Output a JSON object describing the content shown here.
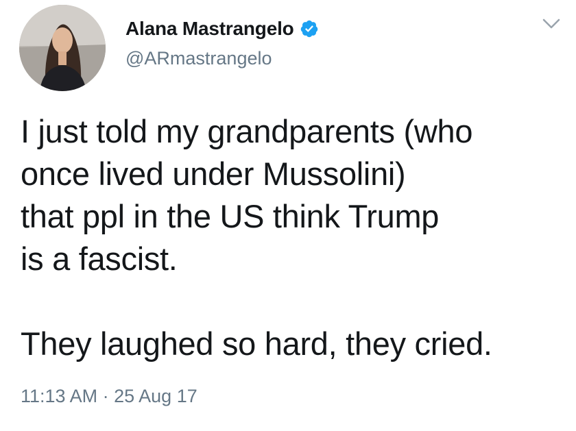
{
  "tweet": {
    "display_name": "Alana Mastrangelo",
    "handle": "@ARmastrangelo",
    "verified_icon": "verified-badge-icon",
    "menu_icon": "chevron-down-icon",
    "text": "I just told my grandparents (who\nonce lived under Mussolini)\nthat ppl in the US think Trump\nis a fascist.\n\nThey laughed so hard, they cried.",
    "time": "11:13 AM",
    "separator": "·",
    "date": "25 Aug 17"
  },
  "colors": {
    "text": "#14171a",
    "secondary": "#657786",
    "verified": "#1da1f2",
    "background": "#ffffff"
  }
}
